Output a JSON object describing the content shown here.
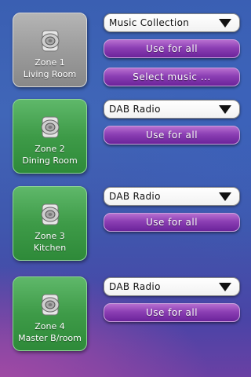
{
  "zones": [
    {
      "label_line1": "Zone 1",
      "label_line2": "Living Room",
      "source": "Music Collection",
      "use_for_all": "Use for all",
      "extra_button": "Select music ...",
      "icon": "speaker-icon"
    },
    {
      "label_line1": "Zone 2",
      "label_line2": "Dining Room",
      "source": "DAB Radio",
      "use_for_all": "Use for all",
      "icon": "speaker-icon"
    },
    {
      "label_line1": "Zone 3",
      "label_line2": "Kitchen",
      "source": "DAB Radio",
      "use_for_all": "Use for all",
      "icon": "speaker-icon"
    },
    {
      "label_line1": "Zone 4",
      "label_line2": "Master B/room",
      "source": "DAB Radio",
      "use_for_all": "Use for all",
      "icon": "speaker-icon"
    }
  ],
  "colors": {
    "active_zone": "#9c9c9c",
    "zone_tile": "#3e9b48",
    "button": "#8c3fb4",
    "dropdown": "#ffffff"
  }
}
